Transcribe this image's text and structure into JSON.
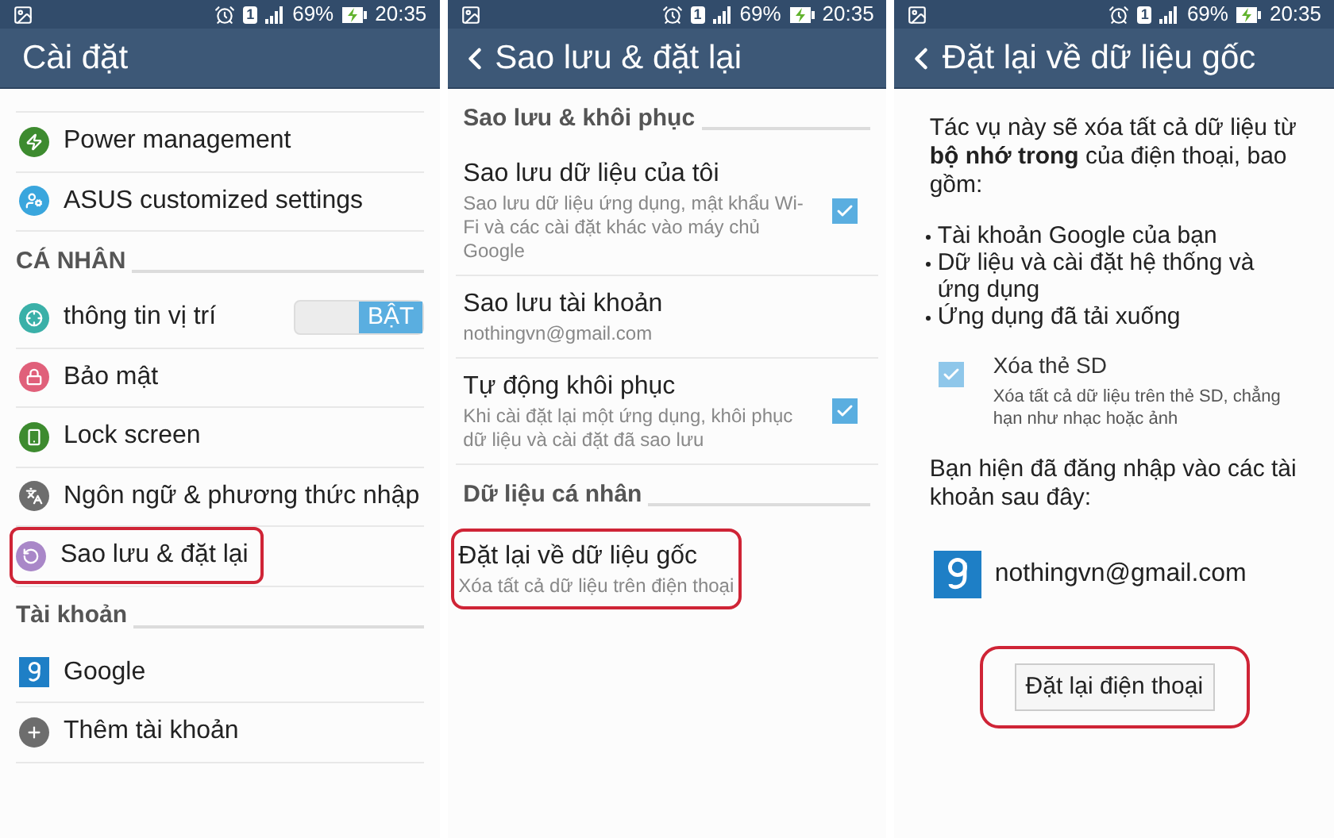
{
  "screens": [
    {
      "status_bar": {
        "sim": "1",
        "battery": "69%",
        "time": "20:35"
      },
      "title": "Cài đặt",
      "back": false,
      "rows": [
        {
          "kind": "item",
          "label": "Power management",
          "color": "#3d8b2f",
          "highlighted": false
        },
        {
          "kind": "item",
          "label": "ASUS customized settings",
          "color": "#3aa6dd",
          "highlighted": false
        },
        {
          "kind": "header",
          "label": "CÁ NHÂN"
        },
        {
          "kind": "item",
          "label": "thông tin vị trí",
          "color": "#3ab0a8",
          "highlighted": false,
          "toggle": {
            "label": "BẬT",
            "on": true
          }
        },
        {
          "kind": "item",
          "label": "Bảo mật",
          "color": "#e0607a",
          "highlighted": false
        },
        {
          "kind": "item",
          "label": "Lock screen",
          "color": "#3d8b2f",
          "highlighted": false
        },
        {
          "kind": "item",
          "label": "Ngôn ngữ & phương thức nhập",
          "color": "#6d6d6d",
          "highlighted": false
        },
        {
          "kind": "item",
          "label": "Sao lưu & đặt lại",
          "color": "#a987c8",
          "highlighted": true
        },
        {
          "kind": "header",
          "label": "Tài khoản"
        },
        {
          "kind": "account",
          "label": "Google",
          "highlighted": false
        },
        {
          "kind": "item",
          "label": "Thêm tài khoản",
          "color": "#6d6d6d",
          "highlighted": false
        }
      ]
    },
    {
      "status_bar": {
        "sim": "1",
        "battery": "69%",
        "time": "20:35"
      },
      "title": "Sao lưu & đặt lại",
      "back": true,
      "rows": [
        {
          "kind": "header",
          "label": "Sao lưu & khôi phục"
        },
        {
          "kind": "option",
          "label": "Sao lưu dữ liệu của tôi",
          "summary": "Sao lưu dữ liệu ứng dụng, mật khẩu Wi-Fi và các cài đặt khác vào máy chủ Google",
          "checked": true,
          "highlighted": false
        },
        {
          "kind": "option",
          "label": "Sao lưu tài khoản",
          "summary": "nothingvn@gmail.com",
          "highlighted": false
        },
        {
          "kind": "option",
          "label": "Tự động khôi phục",
          "summary": "Khi cài đặt lại một ứng dụng, khôi phục dữ liệu và cài đặt đã sao lưu",
          "checked": true,
          "highlighted": false
        },
        {
          "kind": "header",
          "label": "Dữ liệu cá nhân"
        },
        {
          "kind": "option",
          "label": "Đặt lại về dữ liệu gốc",
          "summary": "Xóa tất cả dữ liệu trên điện thoại",
          "highlighted": true
        }
      ]
    },
    {
      "status_bar": {
        "sim": "1",
        "battery": "69%",
        "time": "20:35"
      },
      "title": "Đặt lại về dữ liệu gốc",
      "back": true,
      "rows": [
        {
          "kind": "paragraph",
          "text": "Tác vụ này sẽ xóa tất cả dữ liệu từ **bộ nhớ trong** của điện thoại, bao gồm:"
        },
        {
          "kind": "bullets",
          "items": [
            "Tài khoản Google của bạn",
            "Dữ liệu và cài đặt hệ thống và ứng dụng",
            "Ứng dụng đã tải xuống"
          ]
        },
        {
          "kind": "check",
          "label": "Xóa thẻ SD",
          "summary": "Xóa tất cả dữ liệu trên thẻ SD, chẳng hạn như nhạc hoặc ảnh",
          "checked": true
        },
        {
          "kind": "paragraph",
          "text": "Bạn hiện đã đăng nhập vào các tài khoản sau đây:"
        },
        {
          "kind": "signed_in",
          "label": "nothingvn@gmail.com"
        },
        {
          "kind": "button",
          "label": "Đặt lại điện thoại",
          "highlighted": true
        }
      ]
    }
  ]
}
